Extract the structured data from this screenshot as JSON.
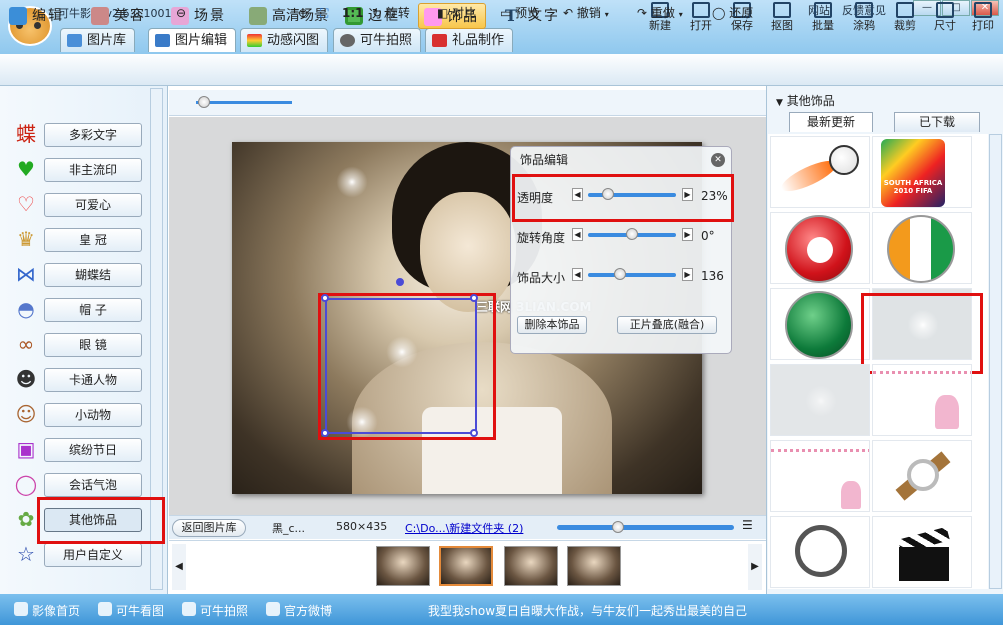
{
  "app": {
    "title": "可牛影像 v2.6.0.1001",
    "links": [
      "网站",
      "反馈意见"
    ],
    "window_buttons": [
      "—",
      "□",
      "✕"
    ]
  },
  "main_tabs": [
    "图片库",
    "图片编辑",
    "动感闪图",
    "可牛拍照",
    "礼品制作"
  ],
  "tool_tabs": [
    "编辑",
    "美容",
    "场景",
    "高清场景",
    "边框",
    "饰品",
    "文字"
  ],
  "tools": [
    "新建",
    "打开",
    "保存",
    "抠图",
    "批量",
    "涂鸦",
    "裁剪",
    "尺寸",
    "打印"
  ],
  "edit_bar": {
    "fit": "1:1",
    "rotate": "旋转",
    "compare": "对比",
    "preview": "预览",
    "undo": "撤销",
    "redo": "重做",
    "restore": "还原"
  },
  "categories": [
    "多彩文字",
    "非主流印",
    "可爱心",
    "皇 冠",
    "蝴蝶结",
    "帽 子",
    "眼 镜",
    "卡通人物",
    "小动物",
    "缤纷节日",
    "会话气泡",
    "其他饰品",
    "用户自定义"
  ],
  "dialog": {
    "title": "饰品编辑",
    "close": "✕",
    "rows": [
      {
        "label": "透明度",
        "value": "23%",
        "level": 0.23
      },
      {
        "label": "旋转角度",
        "value": "0°",
        "level": 0.5
      },
      {
        "label": "饰品大小",
        "value": "136",
        "level": 0.36
      }
    ],
    "delete_btn": "删除本饰品",
    "blend_btn": "正片叠底(融合)"
  },
  "watermark": "三联网 3LIAN.COM",
  "status": {
    "back_btn": "返回图片库",
    "filename": "黑_c...",
    "size": "580×435",
    "path": "C:\\Do...\\新建文件夹 (2)"
  },
  "right_panel": {
    "header": "其他饰品",
    "tabs": [
      "最新更新",
      "已下载"
    ],
    "items": [
      "fire-football",
      "south-africa-2010-fifa",
      "tunisia-flag",
      "ivory-coast-flag",
      "saudi-arabia-flag",
      "sparkle",
      "sparkle-dim",
      "flower-border-top",
      "flower-border-left",
      "wrist-watch",
      "alarm-clock",
      "clapperboard"
    ],
    "fifa_text": "SOUTH AFRICA 2010 FIFA"
  },
  "bottom_bar": {
    "items": [
      "影像首页",
      "可牛看图",
      "可牛拍照",
      "官方微博"
    ],
    "slogan": "我型我show夏日自曝大作战，与牛友们一起秀出最美的自己"
  }
}
